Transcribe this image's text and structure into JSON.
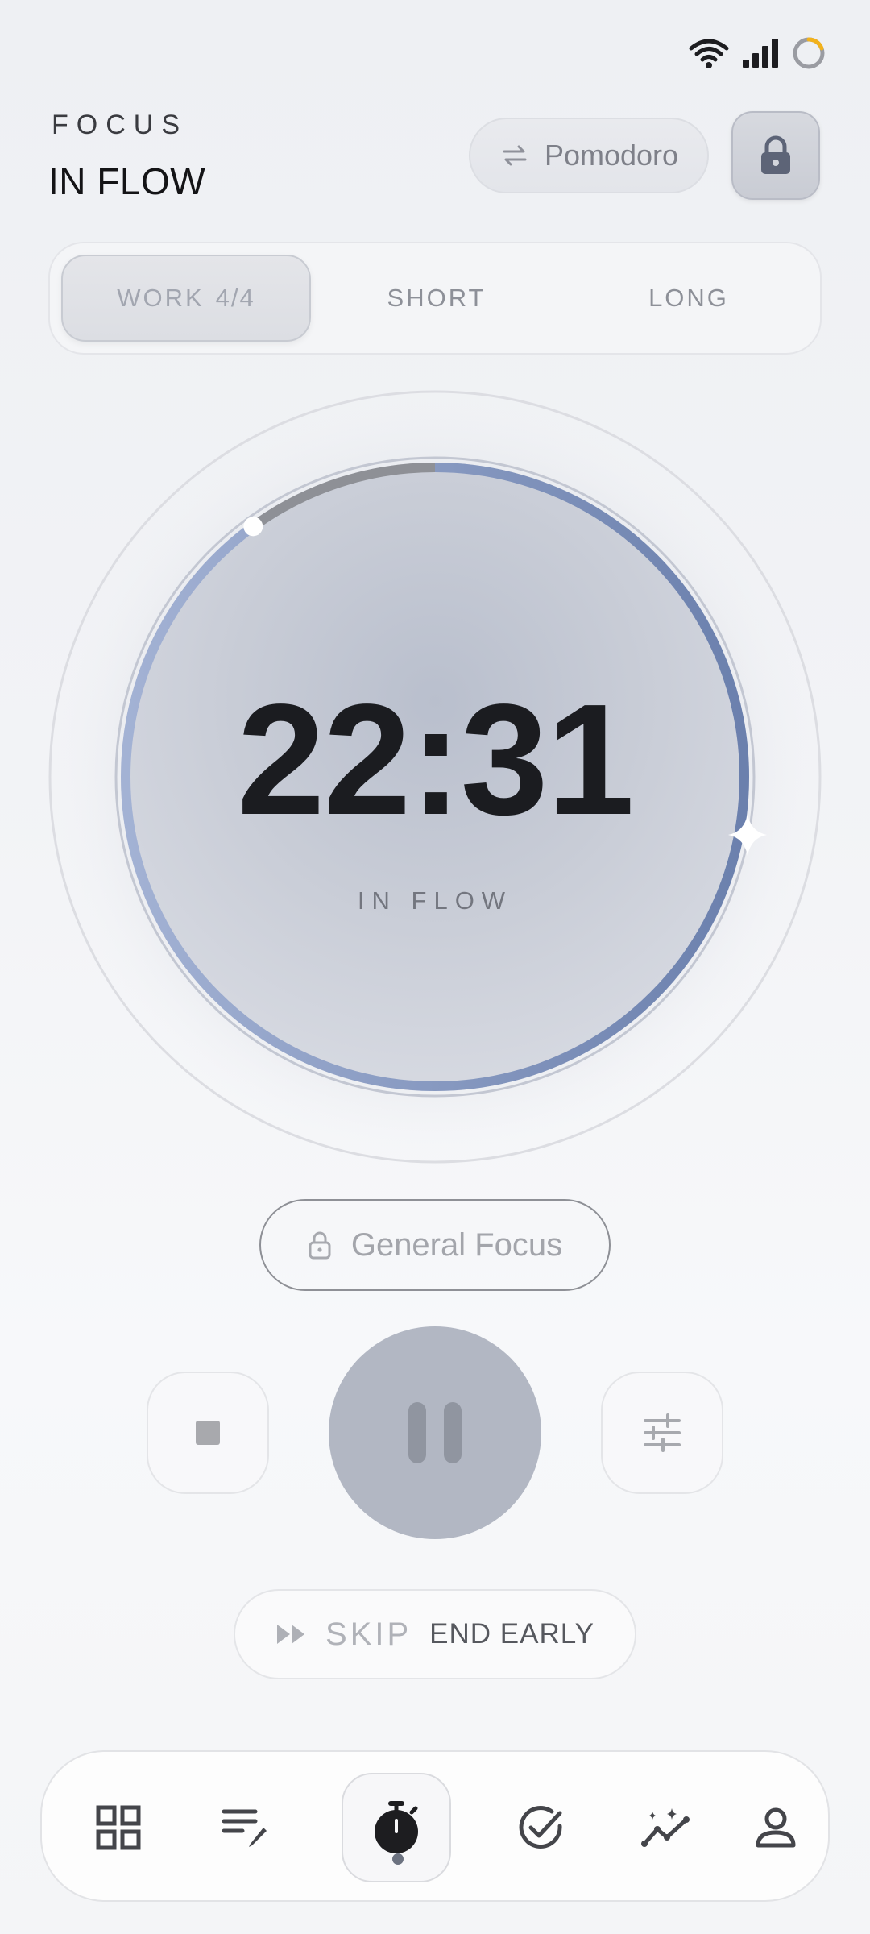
{
  "header": {
    "app_label": "FOCUS",
    "app_title": "IN FLOW",
    "mode_label": "Pomodoro"
  },
  "tabs": [
    {
      "label": "WORK",
      "count": "4/4",
      "active": true
    },
    {
      "label": "SHORT",
      "active": false
    },
    {
      "label": "LONG",
      "active": false
    }
  ],
  "timer": {
    "time": "22:31",
    "status": "IN FLOW",
    "progress_remaining": 0.9
  },
  "focus_tag": "General Focus",
  "skip": {
    "skip_label": "SKIP",
    "end_label": "END EARLY"
  },
  "nav": [
    {
      "icon": "grid-icon",
      "active": false
    },
    {
      "icon": "notes-edit-icon",
      "active": false
    },
    {
      "icon": "stopwatch-icon",
      "active": true
    },
    {
      "icon": "check-circle-icon",
      "active": false
    },
    {
      "icon": "insights-icon",
      "active": false
    },
    {
      "icon": "profile-icon",
      "active": false
    }
  ],
  "colors": {
    "accent": "#7b90bd",
    "battery": "#f2b21c"
  }
}
